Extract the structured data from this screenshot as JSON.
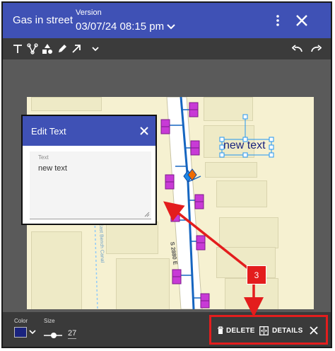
{
  "header": {
    "title": "Gas in street",
    "version_label": "Version",
    "version_value": "03/07/24 08:15 pm"
  },
  "toolbar": {
    "tools": [
      "text-tool-icon",
      "polyline-tool-icon",
      "shapes-tool-icon",
      "pen-tool-icon",
      "arrow-tool-icon",
      "chevron-down-icon"
    ],
    "undo": "undo-icon",
    "redo": "redo-icon"
  },
  "map": {
    "street_label": "S 2880 E",
    "canal_label": "East Bench Canal",
    "annotation_text": "new text",
    "line_color": "#1565c0",
    "marker_color": "#c83ad6"
  },
  "edit_dialog": {
    "title": "Edit Text",
    "field_label": "Text",
    "field_value": "new text"
  },
  "bottom_bar": {
    "color_label": "Color",
    "color_value": "#1a237e",
    "size_label": "Size",
    "size_value": "27",
    "delete_label": "DELETE",
    "details_label": "DETAILS"
  },
  "callout": {
    "number": "3",
    "color": "#e31d1d"
  }
}
